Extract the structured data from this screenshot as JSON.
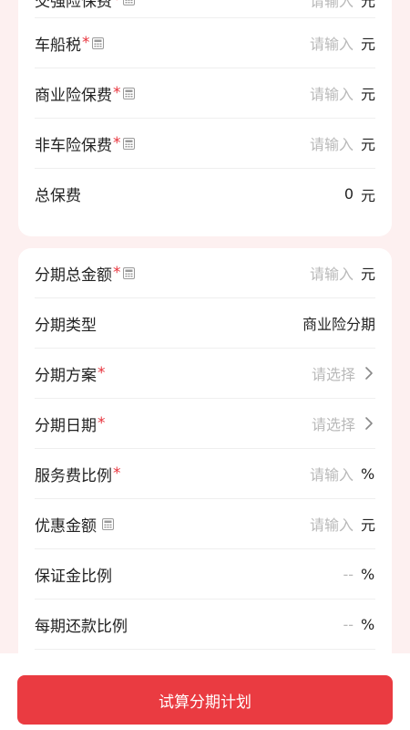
{
  "colors": {
    "accent": "#ea3b41",
    "required": "#e8343d",
    "placeholder": "#b9b9b9",
    "background": "#fdf0f0"
  },
  "premium": {
    "compulsory": {
      "label": "交强险保费",
      "required": "*",
      "icon": "calculator-icon",
      "placeholder": "请输入",
      "unit": "元"
    },
    "vehicle_tax": {
      "label": "车船税",
      "required": "*",
      "icon": "calculator-icon",
      "placeholder": "请输入",
      "unit": "元"
    },
    "commercial": {
      "label": "商业险保费",
      "required": "*",
      "icon": "calculator-icon",
      "placeholder": "请输入",
      "unit": "元"
    },
    "non_vehicle": {
      "label": "非车险保费",
      "required": "*",
      "icon": "calculator-icon",
      "placeholder": "请输入",
      "unit": "元"
    },
    "total": {
      "label": "总保费",
      "value": "0",
      "unit": "元"
    }
  },
  "installment": {
    "total_amount": {
      "label": "分期总金额",
      "required": "*",
      "icon": "calculator-icon",
      "placeholder": "请输入",
      "unit": "元"
    },
    "type": {
      "label": "分期类型",
      "value": "商业险分期"
    },
    "plan": {
      "label": "分期方案",
      "required": "*",
      "placeholder": "请选择",
      "icon": "chevron-right-icon"
    },
    "date": {
      "label": "分期日期",
      "required": "*",
      "placeholder": "请选择",
      "icon": "chevron-right-icon"
    },
    "service_fee": {
      "label": "服务费比例",
      "required": "*",
      "placeholder": "请输入",
      "unit": "%"
    },
    "discount": {
      "label": "优惠金额",
      "icon": "calculator-icon",
      "placeholder": "请输入",
      "unit": "元"
    },
    "deposit_ratio": {
      "label": "保证金比例",
      "value": "--",
      "unit": "%"
    },
    "repay_ratio": {
      "label": "每期还款比例",
      "value": "--",
      "unit": "%"
    }
  },
  "submit_label": "试算分期计划"
}
